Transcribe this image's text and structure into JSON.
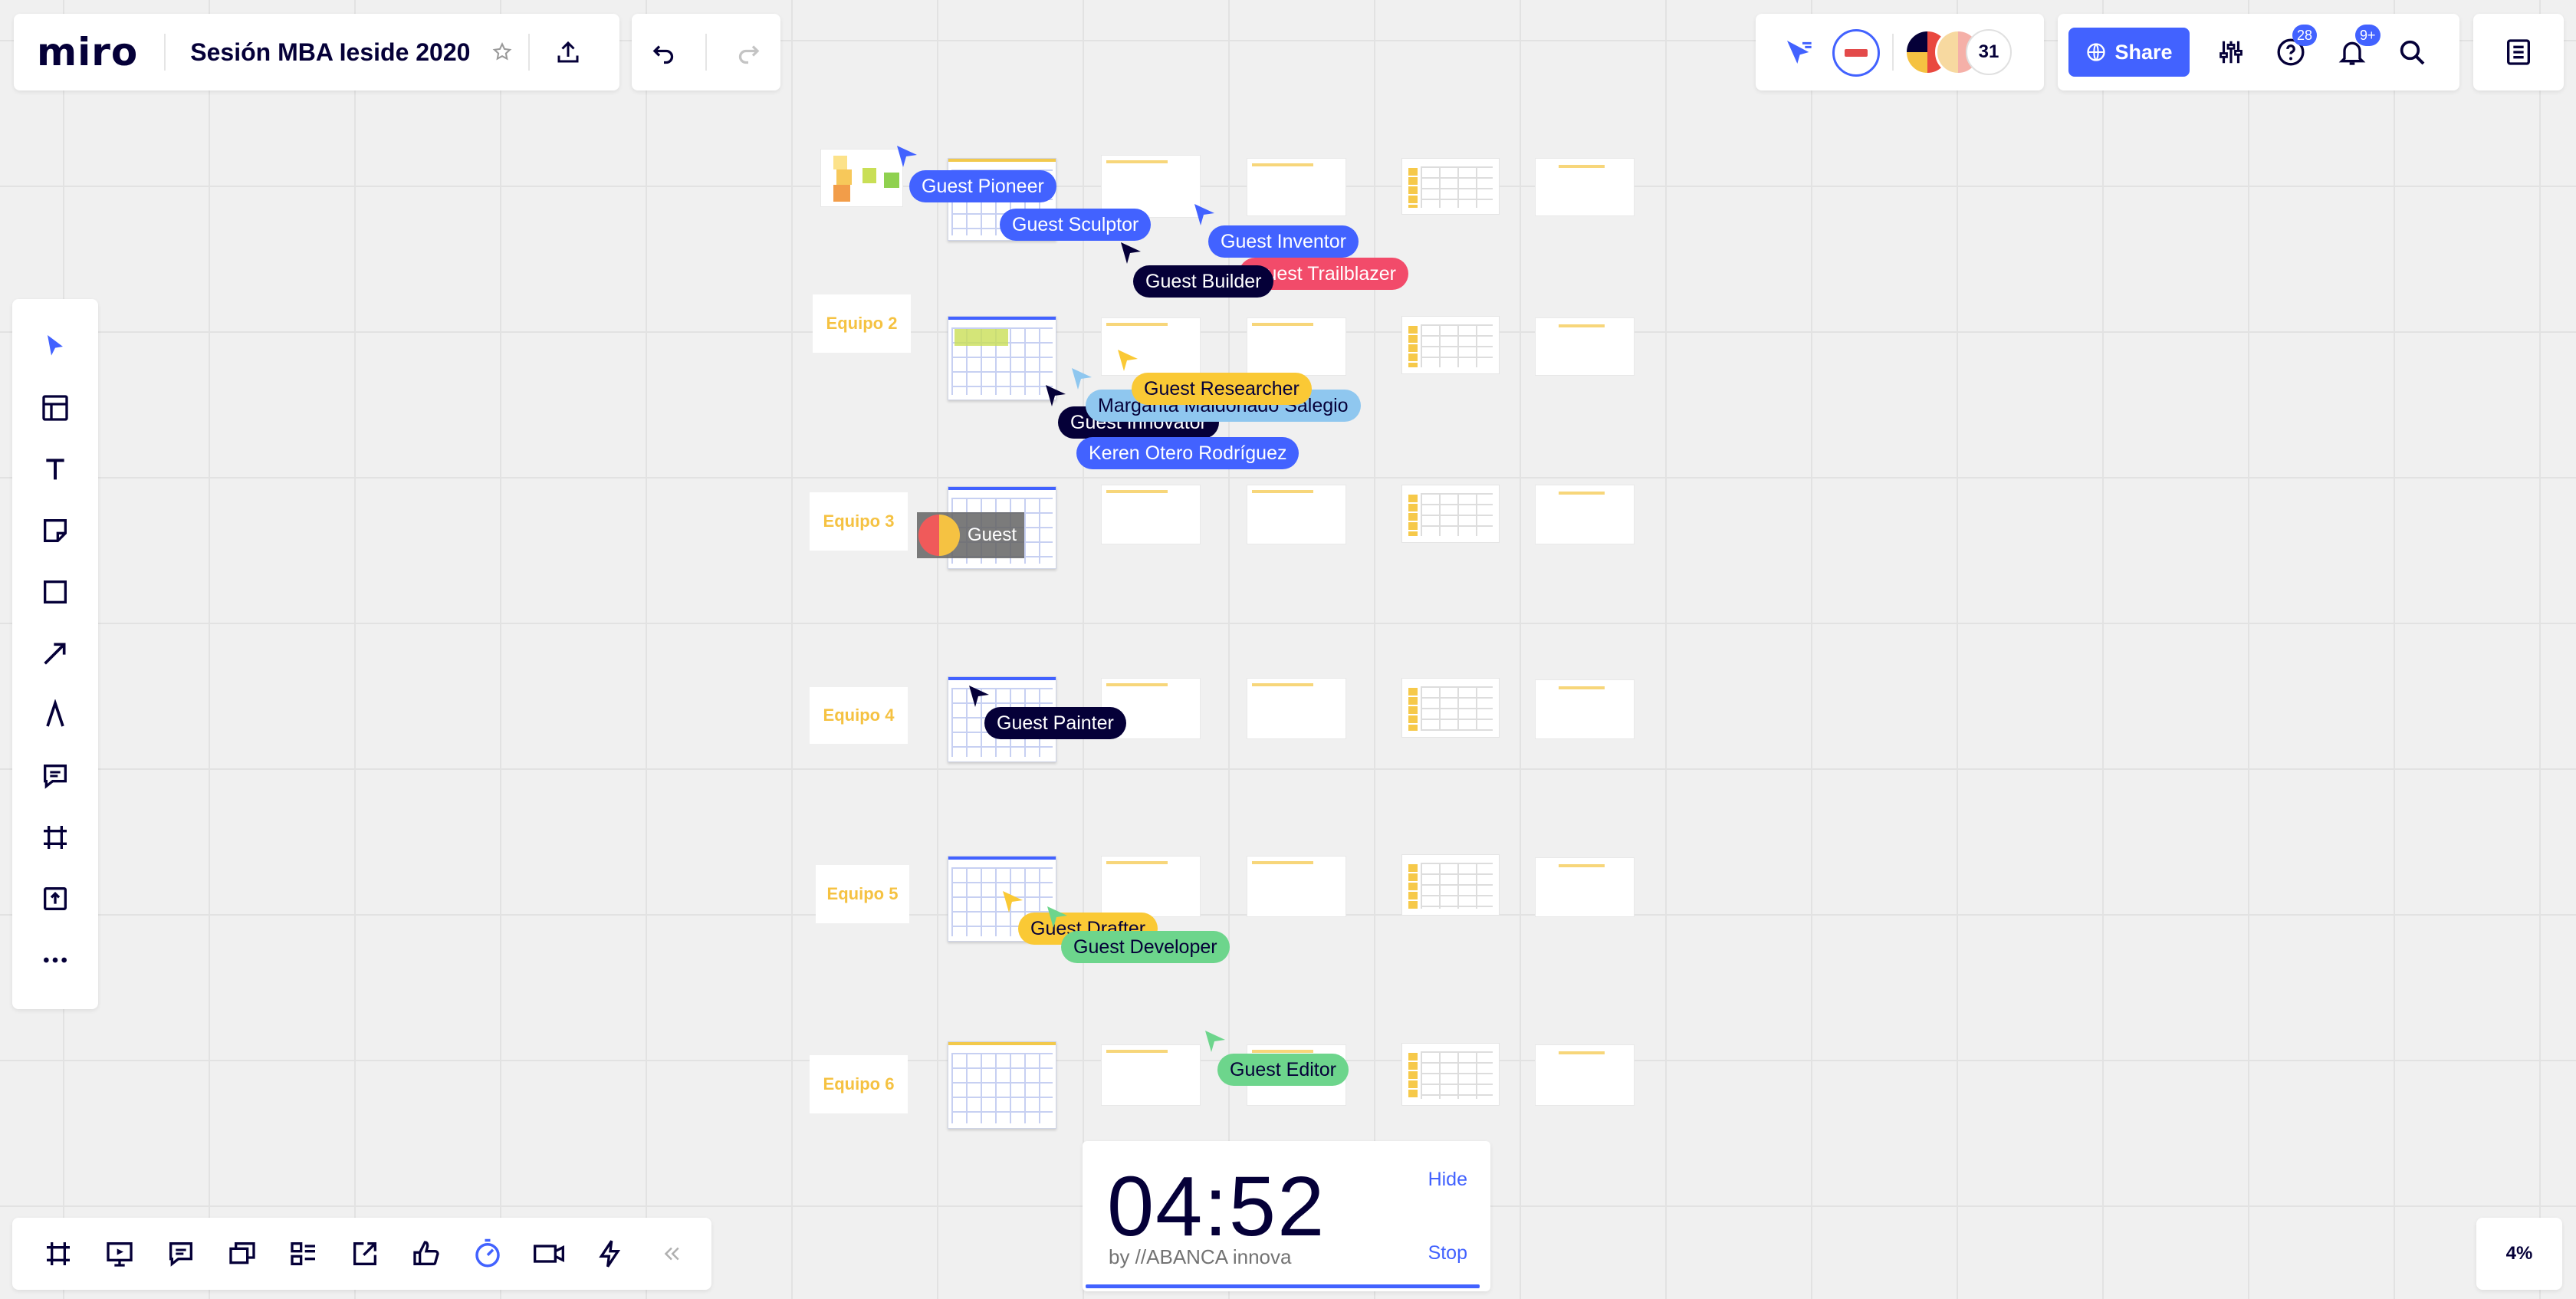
{
  "app": {
    "logo": "miro",
    "board_title": "Sesión MBA Ieside 2020",
    "star_icon": "star-icon",
    "upload_icon": "upload-icon"
  },
  "collaborators": {
    "count": "31"
  },
  "actions": {
    "share_label": "Share",
    "help_badge": "28",
    "notifications_badge": "9+"
  },
  "left_toolbar": [
    {
      "name": "select-tool",
      "icon": "cursor-icon"
    },
    {
      "name": "templates-tool",
      "icon": "templates-icon"
    },
    {
      "name": "text-tool",
      "icon": "text-icon"
    },
    {
      "name": "sticky-note-tool",
      "icon": "sticky-note-icon"
    },
    {
      "name": "shape-tool",
      "icon": "square-icon"
    },
    {
      "name": "connection-line-tool",
      "icon": "arrow-icon"
    },
    {
      "name": "pen-tool",
      "icon": "pen-icon"
    },
    {
      "name": "comment-tool",
      "icon": "comment-icon"
    },
    {
      "name": "frame-tool",
      "icon": "frame-icon"
    },
    {
      "name": "upload-tool",
      "icon": "upload-icon"
    },
    {
      "name": "more-tools",
      "icon": "more-icon"
    }
  ],
  "bottom_toolbar": [
    "frames-icon",
    "presentation-icon",
    "comments-icon",
    "cards-icon",
    "kanban-icon",
    "share-screen-icon",
    "voting-icon",
    "timer-icon",
    "video-icon",
    "lightning-icon",
    "collapse-icon"
  ],
  "timer": {
    "value": "04:52",
    "by": "by //ABANCA innova",
    "hide_label": "Hide",
    "stop_label": "Stop"
  },
  "zoom": "4%",
  "board": {
    "teams": [
      "Equipo 2",
      "Equipo 3",
      "Equipo 4",
      "Equipo 5",
      "Equipo 6"
    ],
    "guest_avatar_label": "Guest"
  },
  "cursors": [
    {
      "label": "Guest Pioneer",
      "color": "#4262ff"
    },
    {
      "label": "Guest Sculptor",
      "color": "#4262ff"
    },
    {
      "label": "Guest Inventor",
      "color": "#4262ff"
    },
    {
      "label": "Guest Trailblazer",
      "color": "#f24b6a"
    },
    {
      "label": "Guest Builder",
      "color": "#050038"
    },
    {
      "label": "Guest Researcher",
      "color": "#fac935"
    },
    {
      "label": "Margarita Maldonado Salegio",
      "color": "#8fc7ef"
    },
    {
      "label": "Guest Innovator",
      "color": "#050038"
    },
    {
      "label": "Keren Otero Rodríguez",
      "color": "#4262ff"
    },
    {
      "label": "Guest Painter",
      "color": "#050038"
    },
    {
      "label": "Guest Drafter",
      "color": "#fac935"
    },
    {
      "label": "Guest Developer",
      "color": "#6dd58c"
    },
    {
      "label": "Guest Editor",
      "color": "#6dd58c"
    }
  ]
}
